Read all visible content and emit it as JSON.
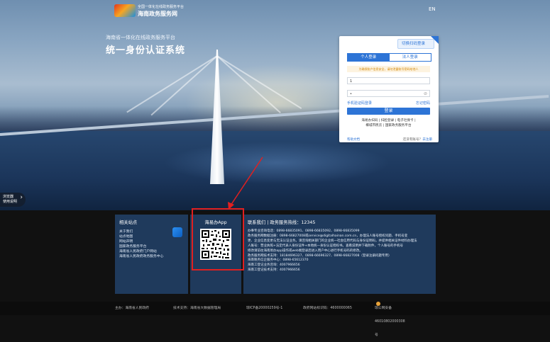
{
  "header": {
    "logo_text": "海南",
    "site_sub": "全国一体化在线政务服务平台",
    "site_name": "海南政务服务网",
    "lang_label": "EN"
  },
  "hero": {
    "subtitle": "海南省一体化在线政务服务平台",
    "title": "统一身份认证系统"
  },
  "guide": {
    "line1": "浏览器",
    "line2": "使用说明",
    "arrow": "›"
  },
  "login": {
    "qr_switch": "切换扫码登录",
    "tabs": [
      {
        "label": "个人登录",
        "active": true
      },
      {
        "label": "法人登录",
        "active": false
      }
    ],
    "notice": "为确保账户信息安全，请勿泄露账号密码给他人",
    "username_value": "1",
    "password_value": "•",
    "phone_login": "手机验证码登录",
    "forgot": "忘记密码",
    "submit": "登录",
    "alt_login_line1": "海易办扫码 | 扫脸登录 | 电子社保卡 |",
    "alt_login_line2": "椰城市民云 | 国家政务服务平台",
    "help": "帮助文档",
    "register_prompt": "还没有账号？",
    "register_link": "去注册"
  },
  "footer": {
    "links_title": "相关站点",
    "links": [
      "关于我们",
      "站点地图",
      "网站声明",
      "国家政务服务平台",
      "海南省人民政府门户网站",
      "海南省人民政府政务服务中心"
    ],
    "app_title": "海易办App",
    "contact_title": "联系我们 | 政务服务热线：12345",
    "contact_lines": [
      "办事专业咨询电话：0898-66835091、0898-66835092、0898-66835099",
      "政务服务网数据注册：0898-66827008或service@digitalhainan.com.cn，办理法人账号授权问题、手机号变",
      "更、企业信息变更与无法认证业务。请咨询相关部门的企业统一社会信用代码与身份证明码，并提供相关证件材料办理法",
      "人账号：营业执照+法定代表人身份证件+本地统一身份认证授权书。查看说明并下载附件，个人账号的手机号",
      "修改请前往海南易办app操作或web端登录后进入用户中心进行手机号码的修改。",
      "政务服务网技术支持：18184696327、0898-66696327、0898-66827008（登录注册问题专用）",
      "海南税务信企服务中心：0898-65612370",
      "海南工登记业务咨询：4007966656",
      "海南工登记技术支持：4007966656"
    ]
  },
  "bottom": {
    "host": "主办：海南省人民政府",
    "tech": "技术支持：海南省大数据管理局",
    "icp": "琼ICP备20000259号-1",
    "gov_id": "政府网站标识码：4600000065",
    "police": "琼公网安备46010802000308号"
  }
}
